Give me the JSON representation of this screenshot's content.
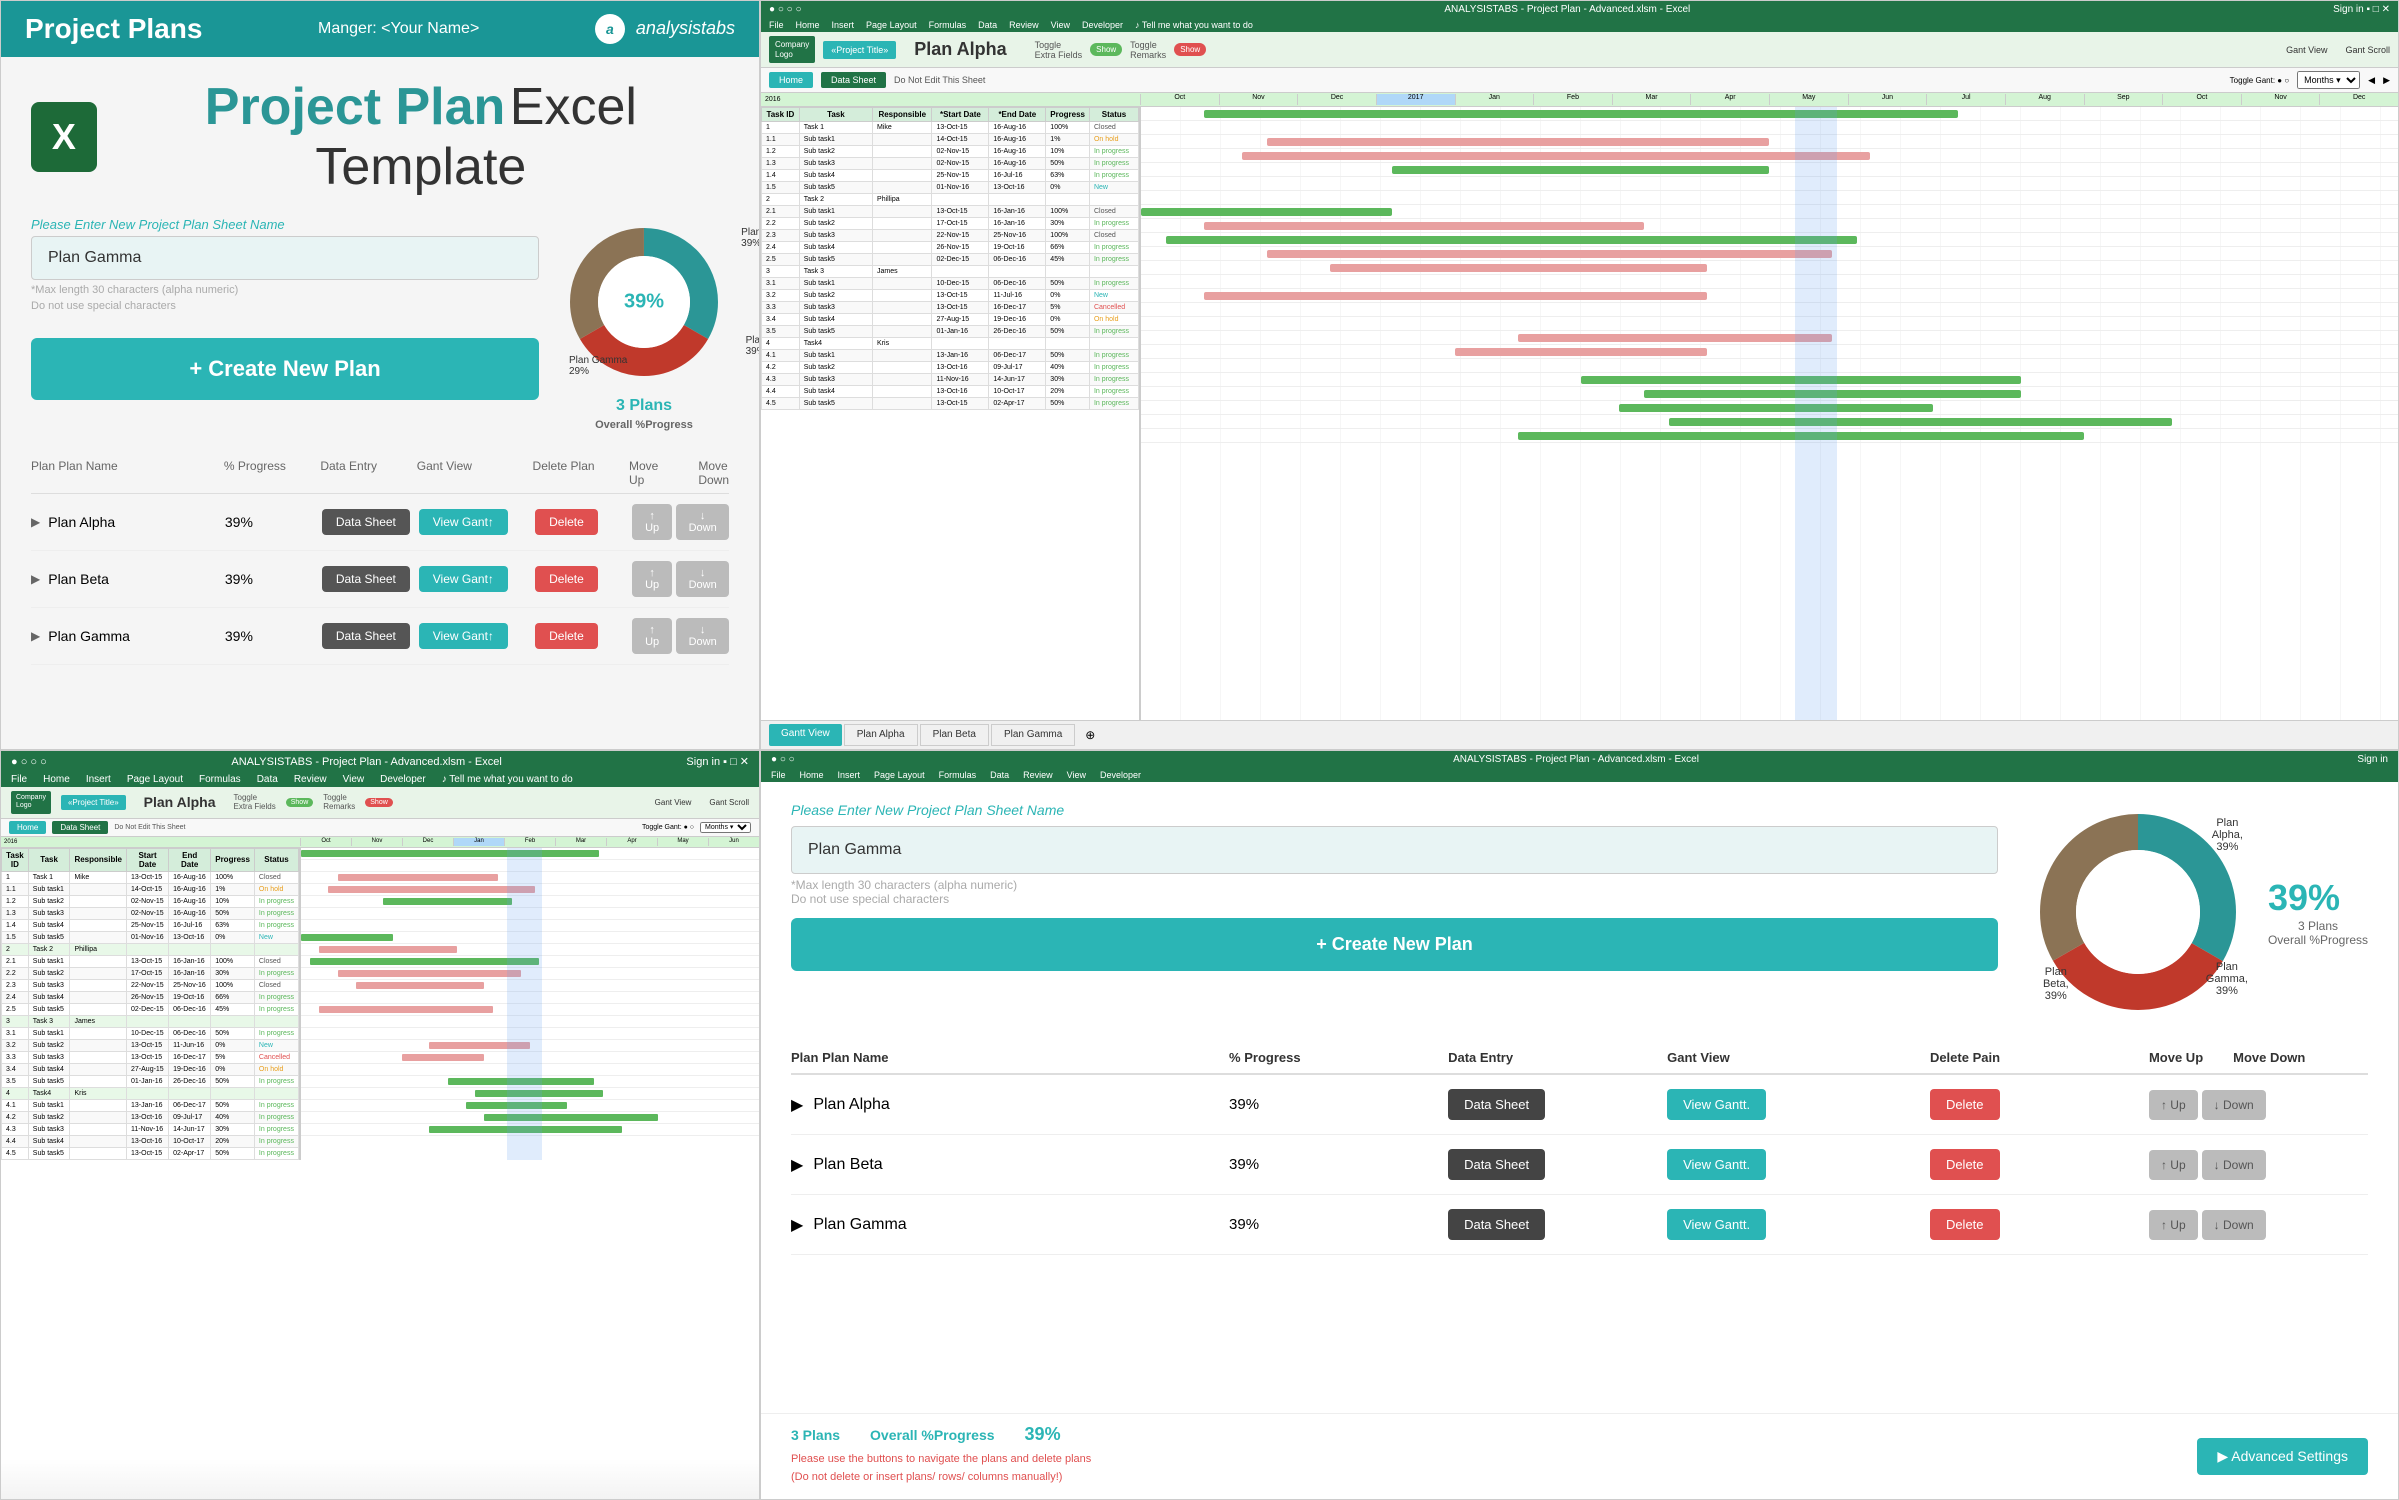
{
  "app": {
    "title": "Project Plans",
    "manager": "Manger: <Your Name>",
    "logo_text": "analysistabs"
  },
  "main_title": {
    "bold": "Project Plan",
    "light": "Excel Template"
  },
  "input": {
    "label": "Please Enter New Project Plan Sheet Name",
    "value": "Plan Gamma",
    "hint1": "*Max length 30 characters (alpha numeric)",
    "hint2": "Do not use special characters"
  },
  "create_button": "+ Create New Plan",
  "donut": {
    "percentage": "39%",
    "plans_count": "3 Plans",
    "overall_label": "Overall %Progress",
    "segments": [
      {
        "label": "Plan Alpha",
        "pct": "39%",
        "color": "#2b9696",
        "value": 33
      },
      {
        "label": "Plan Beta",
        "pct": "39%",
        "color": "#c0392b",
        "value": 33
      },
      {
        "label": "Plan Gamma",
        "pct": "39%",
        "color": "#8b7355",
        "value": 34
      }
    ]
  },
  "table": {
    "headers": [
      "Plan Plan Name",
      "% Progress",
      "Data Entry",
      "Gant View",
      "Delete Plan",
      "Move Up",
      "Move Down"
    ],
    "rows": [
      {
        "name": "Plan Alpha",
        "progress": "39%",
        "data_sheet": "Data Sheet",
        "view_gant": "View Gant↑",
        "delete": "Delete",
        "up": "↑ Up",
        "down": "↓ Down"
      },
      {
        "name": "Plan Beta",
        "progress": "39%",
        "data_sheet": "Data Sheet",
        "view_gant": "View Gant↑",
        "delete": "Delete",
        "up": "↑ Up",
        "down": "↓ Down"
      },
      {
        "name": "Plan Gamma",
        "progress": "39%",
        "data_sheet": "Data Sheet",
        "view_gant": "View Gant↑",
        "delete": "Delete",
        "up": "↑ Up",
        "down": "↓ Down"
      }
    ]
  },
  "excel": {
    "title": "ANALYSISTABS - Project Plan - Advanced.xlsm - Excel",
    "plan_title": "Plan Alpha",
    "project_title_label": "«Project Title»",
    "tabs": [
      "Home",
      "Data Sheet",
      "Gantt View",
      "Plan Alpha",
      "Plan Beta",
      "Plan Gamma"
    ],
    "task_columns": [
      "Task ID",
      "Task",
      "Responsible",
      "*Start Date",
      "*End Date",
      "Progress",
      "Status"
    ],
    "tasks": [
      {
        "id": "1",
        "task": "Task 1",
        "resp": "Mike",
        "start": "13-Oct-15",
        "end": "16-Aug-16",
        "prog": "100%",
        "status": "Closed"
      },
      {
        "id": "1.1",
        "task": "Sub task1",
        "resp": "",
        "start": "14-Oct-15",
        "end": "16-Aug-16",
        "prog": "1%",
        "status": "On hold"
      },
      {
        "id": "1.2",
        "task": "Sub task2",
        "resp": "",
        "start": "02-Nov-15",
        "end": "16-Aug-16",
        "prog": "10%",
        "status": "In progress"
      },
      {
        "id": "1.3",
        "task": "Sub task3",
        "resp": "",
        "start": "02-Nov-15",
        "end": "16-Aug-16",
        "prog": "50%",
        "status": "In progress"
      },
      {
        "id": "1.4",
        "task": "Sub task4",
        "resp": "",
        "start": "25-Nov-15",
        "end": "16-Jul-16",
        "prog": "63%",
        "status": "In progress"
      },
      {
        "id": "1.5",
        "task": "Sub task5",
        "resp": "",
        "start": "01-Nov-16",
        "end": "13-Oct-16",
        "prog": "0%",
        "status": "New"
      },
      {
        "id": "2",
        "task": "Task 2",
        "resp": "Phillipa",
        "start": "",
        "end": "",
        "prog": "",
        "status": ""
      },
      {
        "id": "2.1",
        "task": "Sub task1",
        "resp": "",
        "start": "13-Oct-15",
        "end": "16-Jan-16",
        "prog": "100%",
        "status": "Closed"
      },
      {
        "id": "2.2",
        "task": "Sub task2",
        "resp": "",
        "start": "17-Oct-15",
        "end": "16-Jan-16",
        "prog": "30%",
        "status": "In progress"
      },
      {
        "id": "2.3",
        "task": "Sub task3",
        "resp": "",
        "start": "22-Nov-15",
        "end": "25-Nov-16",
        "prog": "100%",
        "status": "Closed"
      },
      {
        "id": "2.4",
        "task": "Sub task4",
        "resp": "",
        "start": "26-Nov-15",
        "end": "19-Oct-16",
        "prog": "66%",
        "status": "In progress"
      },
      {
        "id": "2.5",
        "task": "Sub task5",
        "resp": "",
        "start": "02-Dec-15",
        "end": "06-Dec-16",
        "prog": "45%",
        "status": "In progress"
      },
      {
        "id": "3",
        "task": "Task 3",
        "resp": "James",
        "start": "",
        "end": "",
        "prog": "",
        "status": ""
      },
      {
        "id": "3.1",
        "task": "Sub task1",
        "resp": "",
        "start": "10-Dec-15",
        "end": "06-Dec-16",
        "prog": "50%",
        "status": "In progress"
      },
      {
        "id": "3.2",
        "task": "Sub task2",
        "resp": "",
        "start": "13-Oct-15",
        "end": "11-Jul-16",
        "prog": "0%",
        "status": "New"
      },
      {
        "id": "3.3",
        "task": "Sub task3",
        "resp": "",
        "start": "13-Oct-15",
        "end": "16-Dec-17",
        "prog": "5%",
        "status": "Cancelled"
      },
      {
        "id": "3.4",
        "task": "Sub task4",
        "resp": "",
        "start": "27-Aug-15",
        "end": "19-Dec-16",
        "prog": "0%",
        "status": "On hold"
      },
      {
        "id": "3.5",
        "task": "Sub task5",
        "resp": "",
        "start": "01-Jan-16",
        "end": "26-Dec-16",
        "prog": "50%",
        "status": "In progress"
      },
      {
        "id": "4",
        "task": "Task4",
        "resp": "Kris",
        "start": "",
        "end": "",
        "prog": "",
        "status": ""
      },
      {
        "id": "4.1",
        "task": "Sub task1",
        "resp": "",
        "start": "13-Jan-16",
        "end": "06-Dec-17",
        "prog": "50%",
        "status": "In progress"
      },
      {
        "id": "4.2",
        "task": "Sub task2",
        "resp": "",
        "start": "13-Oct-16",
        "end": "09-Jul-17",
        "prog": "40%",
        "status": "In progress"
      },
      {
        "id": "4.3",
        "task": "Sub task3",
        "resp": "",
        "start": "11-Nov-16",
        "end": "14-Jun-17",
        "prog": "30%",
        "status": "In progress"
      },
      {
        "id": "4.4",
        "task": "Sub task4",
        "resp": "",
        "start": "13-Oct-16",
        "end": "10-Oct-17",
        "prog": "20%",
        "status": "In progress"
      },
      {
        "id": "4.5",
        "task": "Sub task5",
        "resp": "",
        "start": "13-Oct-15",
        "end": "02-Apr-17",
        "prog": "50%",
        "status": "In progress"
      }
    ]
  },
  "bottom_right": {
    "input_label": "Please Enter New Project Plan Sheet Name",
    "input_value": "Plan Gamma",
    "hint1": "*Max length 30 characters (alpha numeric)",
    "hint2": "Do not use special characters",
    "create_btn": "+ Create New Plan",
    "percentage": "39%",
    "plans_count": "3 Plans",
    "overall_label": "Overall %Progress",
    "table_headers": [
      "Plan Plan Name",
      "% Progress",
      "Data Entry",
      "Gant View",
      "Delete Pain",
      "Move Up",
      "Move Down"
    ],
    "rows": [
      {
        "name": "Plan Alpha",
        "progress": "39%"
      },
      {
        "name": "Plan Beta",
        "progress": "39%"
      },
      {
        "name": "Plan Gamma",
        "progress": "39%"
      }
    ],
    "footer": {
      "plans_label": "3 Plans",
      "overall_label": "Overall %Progress",
      "pct": "39%",
      "note": "Please use the buttons to navigate the plans and delete plans",
      "note2": "(Do not delete or insert plans/ rows/ columns manually!)",
      "adv_btn": "▶ Advanced Settings"
    }
  }
}
